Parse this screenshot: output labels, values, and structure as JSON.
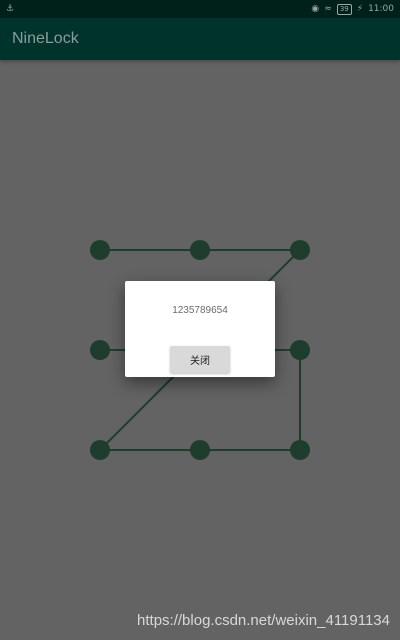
{
  "status_bar": {
    "time": "11:00",
    "battery": "39",
    "left_icon": "usb-icon",
    "icons": [
      "eye-icon",
      "wifi-icon",
      "battery-icon",
      "charging-icon"
    ]
  },
  "app_bar": {
    "title": "NineLock"
  },
  "pattern": {
    "node_color": "#1f3d2d",
    "line_color": "#1f3d2d",
    "sequence": [
      1,
      2,
      3,
      5,
      7,
      8,
      9,
      6,
      5,
      4
    ]
  },
  "dialog": {
    "message": "1235789654",
    "close_label": "关闭"
  },
  "watermark": "https://blog.csdn.net/weixin_41191134"
}
